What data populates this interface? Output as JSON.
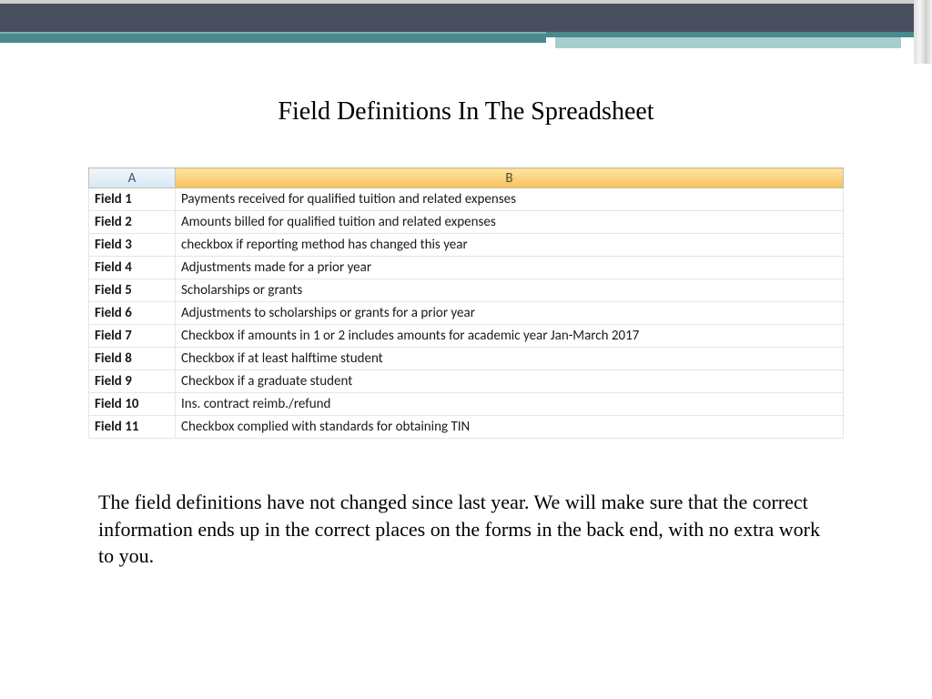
{
  "title": "Field Definitions In The Spreadsheet",
  "columns": {
    "a": "A",
    "b": "B"
  },
  "rows": [
    {
      "label": "Field 1",
      "desc": "Payments received for qualified tuition and related expenses"
    },
    {
      "label": "Field 2",
      "desc": "Amounts billed for qualified tuition and related expenses"
    },
    {
      "label": "Field 3",
      "desc": "checkbox if reporting method has changed this year"
    },
    {
      "label": "Field 4",
      "desc": "Adjustments made for a prior year"
    },
    {
      "label": "Field 5",
      "desc": "Scholarships or grants"
    },
    {
      "label": "Field 6",
      "desc": "Adjustments to scholarships or grants for a prior year"
    },
    {
      "label": "Field 7",
      "desc": "Checkbox if amounts in 1 or 2 includes amounts for academic year Jan-March 2017"
    },
    {
      "label": "Field 8",
      "desc": "Checkbox if at least halftime student"
    },
    {
      "label": "Field 9",
      "desc": "Checkbox if a graduate student"
    },
    {
      "label": "Field 10",
      "desc": "Ins. contract reimb./refund"
    },
    {
      "label": "Field 11",
      "desc": "Checkbox complied with standards for obtaining TIN"
    }
  ],
  "bodyText": "The field definitions have not changed since last year. We will make sure that the correct information ends up in the correct places on the forms in the back end, with no extra work to you."
}
